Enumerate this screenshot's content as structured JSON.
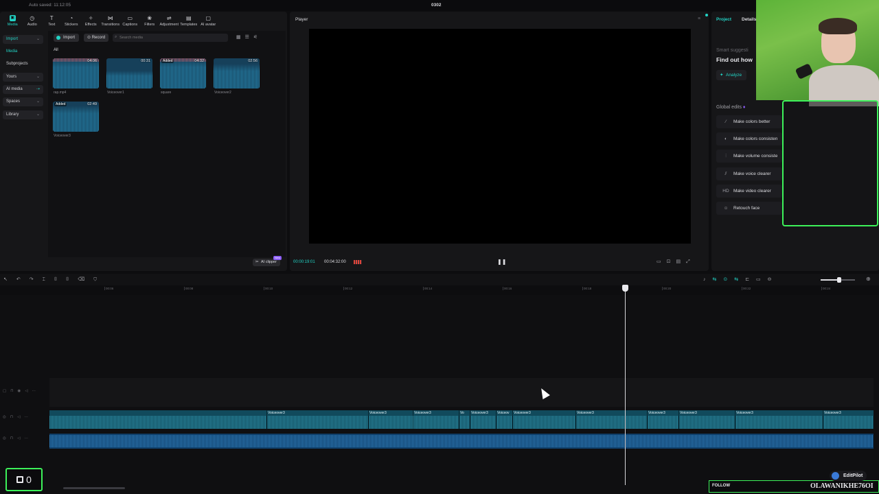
{
  "app": {
    "autosave": "Auto saved: 11:12:05",
    "project_name": "0302"
  },
  "toolbar": {
    "items": [
      {
        "label": "Media",
        "icon": "media-icon"
      },
      {
        "label": "Audio",
        "icon": "audio-icon"
      },
      {
        "label": "Text",
        "icon": "text-icon"
      },
      {
        "label": "Stickers",
        "icon": "stickers-icon"
      },
      {
        "label": "Effects",
        "icon": "effects-icon"
      },
      {
        "label": "Transitions",
        "icon": "transitions-icon"
      },
      {
        "label": "Captions",
        "icon": "captions-icon"
      },
      {
        "label": "Filters",
        "icon": "filters-icon"
      },
      {
        "label": "Adjustment",
        "icon": "adjustment-icon"
      },
      {
        "label": "Templates",
        "icon": "templates-icon"
      },
      {
        "label": "AI avatar",
        "icon": "ai-avatar-icon"
      }
    ]
  },
  "leftnav": {
    "items": [
      "Import",
      "Media",
      "Subprojects",
      "Yours",
      "AI media",
      "Spaces",
      "Library"
    ]
  },
  "media": {
    "import_label": "Import",
    "record_label": "Record",
    "search_placeholder": "Search media",
    "filter_all": "All",
    "clips": [
      {
        "name": "rap.mp4",
        "duration": "04:06",
        "added": ""
      },
      {
        "name": "Voiceover1",
        "duration": "00:31",
        "added": ""
      },
      {
        "name": "square",
        "duration": "04:32",
        "added": "Added"
      },
      {
        "name": "Voiceover2",
        "duration": "02:56",
        "added": ""
      },
      {
        "name": "Voiceover3",
        "duration": "02:49",
        "added": "Added"
      }
    ],
    "clipper_label": "AI clipper",
    "new_badge": "New"
  },
  "player": {
    "title": "Player",
    "current_time": "00:00:19:01",
    "duration": "00:04:32:00"
  },
  "right": {
    "tab_project": "Project",
    "tab_details": "Details",
    "smart_suggestions": "Smart suggesti",
    "find_out": "Find out how",
    "analyze": "Analyze",
    "global_edits": "Global edits",
    "edits": [
      {
        "label": "Make colors better",
        "icon": "wand-icon"
      },
      {
        "label": "Make colors consisten",
        "icon": "palette-icon"
      },
      {
        "label": "Make volume consiste",
        "icon": "sliders-icon"
      },
      {
        "label": "Make voice clearer",
        "icon": "voice-icon"
      },
      {
        "label": "Make video clearer",
        "icon": "hd-icon"
      },
      {
        "label": "Retouch face",
        "icon": "face-icon"
      }
    ]
  },
  "timeline": {
    "ticks": [
      "00:06",
      "00:08",
      "00:10",
      "00:12",
      "00:14",
      "00:16",
      "00:18",
      "00:20",
      "00:22",
      "00:24"
    ],
    "segment_label": "Voiceover3",
    "segment_short": "Vo",
    "segment_mid": "Voiceov"
  },
  "overlay": {
    "counter": "0",
    "follow": "FOLLOW",
    "handle": "OLAWANIKHE76OI",
    "editpilot": "EditPilot"
  }
}
